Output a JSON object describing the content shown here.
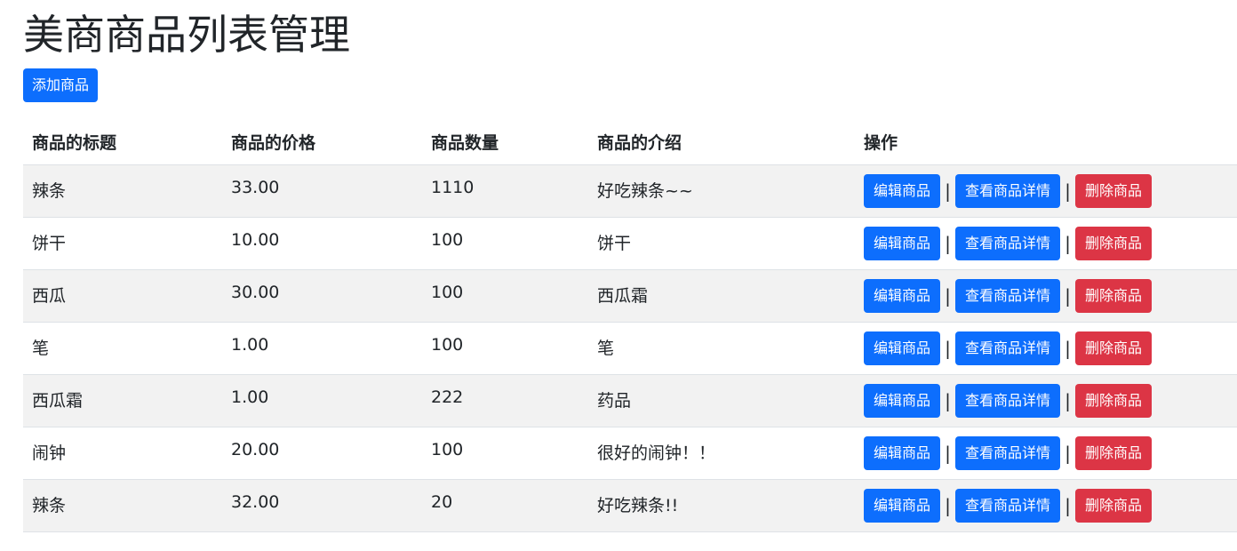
{
  "page": {
    "title": "美商商品列表管理",
    "add_button_label": "添加商品"
  },
  "table": {
    "headers": [
      "商品的标题",
      "商品的价格",
      "商品数量",
      "商品的介绍",
      "操作"
    ],
    "rows": [
      {
        "title": "辣条",
        "price": "33.00",
        "quantity": "1110",
        "description": "好吃辣条~~"
      },
      {
        "title": "饼干",
        "price": "10.00",
        "quantity": "100",
        "description": "饼干"
      },
      {
        "title": "西瓜",
        "price": "30.00",
        "quantity": "100",
        "description": "西瓜霜"
      },
      {
        "title": "笔",
        "price": "1.00",
        "quantity": "100",
        "description": "笔"
      },
      {
        "title": "西瓜霜",
        "price": "1.00",
        "quantity": "222",
        "description": "药品"
      },
      {
        "title": "闹钟",
        "price": "20.00",
        "quantity": "100",
        "description": "很好的闹钟！！"
      },
      {
        "title": "辣条",
        "price": "32.00",
        "quantity": "20",
        "description": "好吃辣条!!"
      }
    ],
    "actions": {
      "edit_label": "编辑商品",
      "view_label": "查看商品详情",
      "delete_label": "删除商品",
      "separator": "|"
    }
  },
  "colors": {
    "primary": "#0d6efd",
    "danger": "#dc3545",
    "striped_row": "#f2f2f2",
    "border": "#dee2e6",
    "text": "#212529"
  }
}
